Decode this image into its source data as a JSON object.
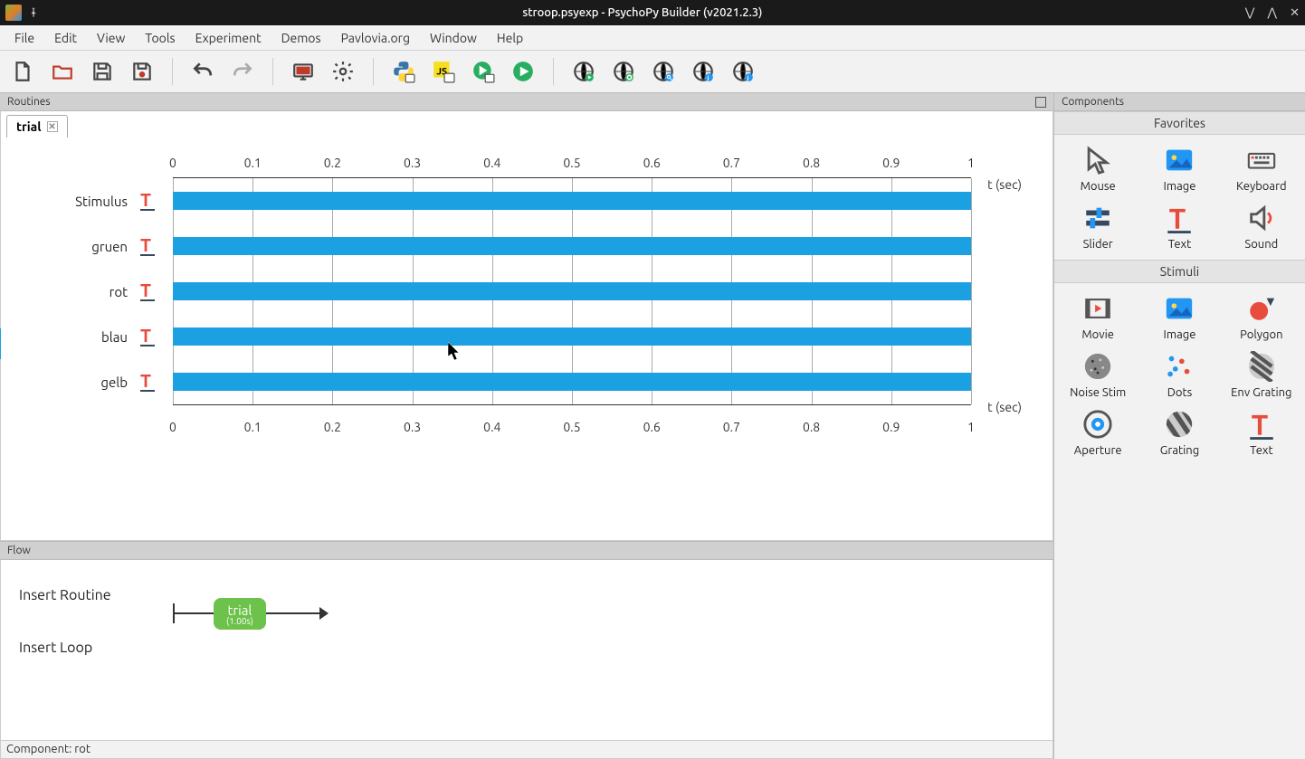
{
  "window": {
    "title": "stroop.psyexp - PsychoPy Builder (v2021.2.3)"
  },
  "menus": [
    "File",
    "Edit",
    "View",
    "Tools",
    "Experiment",
    "Demos",
    "Pavlovia.org",
    "Window",
    "Help"
  ],
  "panels": {
    "routines": "Routines",
    "components": "Components",
    "flow": "Flow"
  },
  "routines": {
    "active_tab": "trial",
    "time_axis_label": "t (sec)",
    "ticks": [
      "0",
      "0.1",
      "0.2",
      "0.3",
      "0.4",
      "0.5",
      "0.6",
      "0.7",
      "0.8",
      "0.9",
      "1"
    ],
    "tracks": [
      {
        "name": "Stimulus",
        "type": "text",
        "start": 0,
        "stop": 1
      },
      {
        "name": "gruen",
        "type": "text",
        "start": 0,
        "stop": 1
      },
      {
        "name": "rot",
        "type": "text",
        "start": 0,
        "stop": 1
      },
      {
        "name": "blau",
        "type": "text",
        "start": 0,
        "stop": 1
      },
      {
        "name": "gelb",
        "type": "text",
        "start": 0,
        "stop": 1
      }
    ]
  },
  "flow": {
    "insert_routine": "Insert Routine",
    "insert_loop": "Insert Loop",
    "node": {
      "name": "trial",
      "duration": "(1.00s)"
    }
  },
  "components": {
    "favorites_label": "Favorites",
    "stimuli_label": "Stimuli",
    "favorites": [
      {
        "label": "Mouse",
        "icon": "mouse-icon"
      },
      {
        "label": "Image",
        "icon": "image-icon"
      },
      {
        "label": "Keyboard",
        "icon": "keyboard-icon"
      },
      {
        "label": "Slider",
        "icon": "slider-icon"
      },
      {
        "label": "Text",
        "icon": "text-icon"
      },
      {
        "label": "Sound",
        "icon": "sound-icon"
      }
    ],
    "stimuli": [
      {
        "label": "Movie",
        "icon": "movie-icon"
      },
      {
        "label": "Image",
        "icon": "image-icon"
      },
      {
        "label": "Polygon",
        "icon": "polygon-icon"
      },
      {
        "label": "Noise Stim",
        "icon": "noise-icon"
      },
      {
        "label": "Dots",
        "icon": "dots-icon"
      },
      {
        "label": "Env Grating",
        "icon": "env-grating-icon"
      },
      {
        "label": "Aperture",
        "icon": "aperture-icon"
      },
      {
        "label": "Grating",
        "icon": "grating-icon"
      },
      {
        "label": "Text",
        "icon": "text-icon"
      }
    ]
  },
  "statusbar": "Component: rot"
}
